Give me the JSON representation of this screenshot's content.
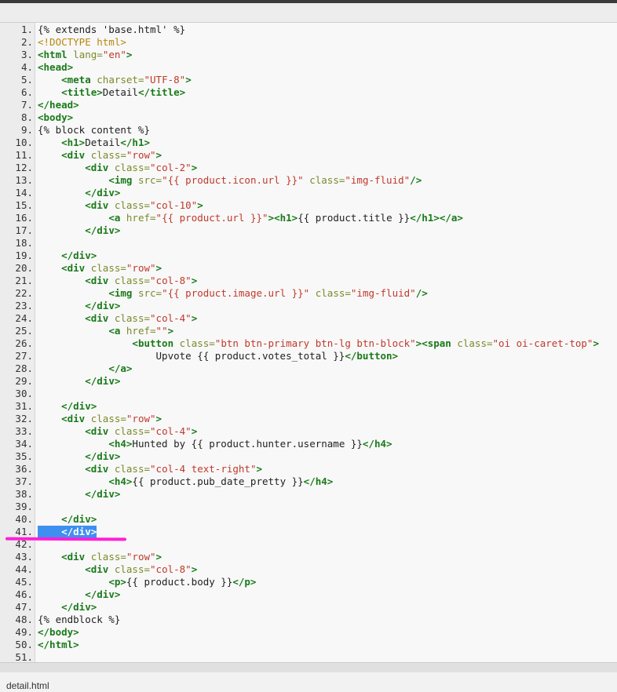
{
  "file": {
    "name": "detail.html"
  },
  "colors": {
    "tag": "#1a7a1a",
    "attr": "#7a8a2a",
    "string": "#c0392b",
    "selection": "#3d8ff0",
    "annotation": "#ff1fd8"
  },
  "selected_line": 41,
  "lines": [
    [
      [
        "tmpl",
        "{% extends 'base.html' %}"
      ]
    ],
    [
      [
        "doctype",
        "<!DOCTYPE html>"
      ]
    ],
    [
      [
        "tag",
        "<html"
      ],
      [
        "text",
        " "
      ],
      [
        "attr",
        "lang="
      ],
      [
        "str",
        "\"en\""
      ],
      [
        "tag",
        ">"
      ]
    ],
    [
      [
        "tag",
        "<head>"
      ]
    ],
    [
      [
        "text",
        "    "
      ],
      [
        "tag",
        "<meta"
      ],
      [
        "text",
        " "
      ],
      [
        "attr",
        "charset="
      ],
      [
        "str",
        "\"UTF-8\""
      ],
      [
        "tag",
        ">"
      ]
    ],
    [
      [
        "text",
        "    "
      ],
      [
        "tag",
        "<title>"
      ],
      [
        "text",
        "Detail"
      ],
      [
        "tag",
        "</title>"
      ]
    ],
    [
      [
        "tag",
        "</head>"
      ]
    ],
    [
      [
        "tag",
        "<body>"
      ]
    ],
    [
      [
        "tmpl",
        "{% block content %}"
      ]
    ],
    [
      [
        "text",
        "    "
      ],
      [
        "tag",
        "<h1>"
      ],
      [
        "text",
        "Detail"
      ],
      [
        "tag",
        "</h1>"
      ]
    ],
    [
      [
        "text",
        "    "
      ],
      [
        "tag",
        "<div"
      ],
      [
        "text",
        " "
      ],
      [
        "attr",
        "class="
      ],
      [
        "str",
        "\"row\""
      ],
      [
        "tag",
        ">"
      ]
    ],
    [
      [
        "text",
        "        "
      ],
      [
        "tag",
        "<div"
      ],
      [
        "text",
        " "
      ],
      [
        "attr",
        "class="
      ],
      [
        "str",
        "\"col-2\""
      ],
      [
        "tag",
        ">"
      ]
    ],
    [
      [
        "text",
        "            "
      ],
      [
        "tag",
        "<img"
      ],
      [
        "text",
        " "
      ],
      [
        "attr",
        "src="
      ],
      [
        "str",
        "\"{{ product.icon.url }}\""
      ],
      [
        "text",
        " "
      ],
      [
        "attr",
        "class="
      ],
      [
        "str",
        "\"img-fluid\""
      ],
      [
        "tag",
        "/>"
      ]
    ],
    [
      [
        "text",
        "        "
      ],
      [
        "tag",
        "</div>"
      ]
    ],
    [
      [
        "text",
        "        "
      ],
      [
        "tag",
        "<div"
      ],
      [
        "text",
        " "
      ],
      [
        "attr",
        "class="
      ],
      [
        "str",
        "\"col-10\""
      ],
      [
        "tag",
        ">"
      ]
    ],
    [
      [
        "text",
        "            "
      ],
      [
        "tag",
        "<a"
      ],
      [
        "text",
        " "
      ],
      [
        "attr",
        "href="
      ],
      [
        "str",
        "\"{{ product.url }}\""
      ],
      [
        "tag",
        "><h1>"
      ],
      [
        "text",
        "{{ product.title }}"
      ],
      [
        "tag",
        "</h1></a>"
      ]
    ],
    [
      [
        "text",
        "        "
      ],
      [
        "tag",
        "</div>"
      ]
    ],
    [],
    [
      [
        "text",
        "    "
      ],
      [
        "tag",
        "</div>"
      ]
    ],
    [
      [
        "text",
        "    "
      ],
      [
        "tag",
        "<div"
      ],
      [
        "text",
        " "
      ],
      [
        "attr",
        "class="
      ],
      [
        "str",
        "\"row\""
      ],
      [
        "tag",
        ">"
      ]
    ],
    [
      [
        "text",
        "        "
      ],
      [
        "tag",
        "<div"
      ],
      [
        "text",
        " "
      ],
      [
        "attr",
        "class="
      ],
      [
        "str",
        "\"col-8\""
      ],
      [
        "tag",
        ">"
      ]
    ],
    [
      [
        "text",
        "            "
      ],
      [
        "tag",
        "<img"
      ],
      [
        "text",
        " "
      ],
      [
        "attr",
        "src="
      ],
      [
        "str",
        "\"{{ product.image.url }}\""
      ],
      [
        "text",
        " "
      ],
      [
        "attr",
        "class="
      ],
      [
        "str",
        "\"img-fluid\""
      ],
      [
        "tag",
        "/>"
      ]
    ],
    [
      [
        "text",
        "        "
      ],
      [
        "tag",
        "</div>"
      ]
    ],
    [
      [
        "text",
        "        "
      ],
      [
        "tag",
        "<div"
      ],
      [
        "text",
        " "
      ],
      [
        "attr",
        "class="
      ],
      [
        "str",
        "\"col-4\""
      ],
      [
        "tag",
        ">"
      ]
    ],
    [
      [
        "text",
        "            "
      ],
      [
        "tag",
        "<a"
      ],
      [
        "text",
        " "
      ],
      [
        "attr",
        "href="
      ],
      [
        "str",
        "\"\""
      ],
      [
        "tag",
        ">"
      ]
    ],
    [
      [
        "text",
        "                "
      ],
      [
        "tag",
        "<button"
      ],
      [
        "text",
        " "
      ],
      [
        "attr",
        "class="
      ],
      [
        "str",
        "\"btn btn-primary btn-lg btn-block\""
      ],
      [
        "tag",
        "><span"
      ],
      [
        "text",
        " "
      ],
      [
        "attr",
        "class="
      ],
      [
        "str",
        "\"oi oi-caret-top\""
      ],
      [
        "tag",
        ">"
      ]
    ],
    [
      [
        "text",
        "                    Upvote {{ product.votes_total }}"
      ],
      [
        "tag",
        "</button>"
      ]
    ],
    [
      [
        "text",
        "            "
      ],
      [
        "tag",
        "</a>"
      ]
    ],
    [
      [
        "text",
        "        "
      ],
      [
        "tag",
        "</div>"
      ]
    ],
    [],
    [
      [
        "text",
        "    "
      ],
      [
        "tag",
        "</div>"
      ]
    ],
    [
      [
        "text",
        "    "
      ],
      [
        "tag",
        "<div"
      ],
      [
        "text",
        " "
      ],
      [
        "attr",
        "class="
      ],
      [
        "str",
        "\"row\""
      ],
      [
        "tag",
        ">"
      ]
    ],
    [
      [
        "text",
        "        "
      ],
      [
        "tag",
        "<div"
      ],
      [
        "text",
        " "
      ],
      [
        "attr",
        "class="
      ],
      [
        "str",
        "\"col-4\""
      ],
      [
        "tag",
        ">"
      ]
    ],
    [
      [
        "text",
        "            "
      ],
      [
        "tag",
        "<h4>"
      ],
      [
        "text",
        "Hunted by {{ product.hunter.username }}"
      ],
      [
        "tag",
        "</h4>"
      ]
    ],
    [
      [
        "text",
        "        "
      ],
      [
        "tag",
        "</div>"
      ]
    ],
    [
      [
        "text",
        "        "
      ],
      [
        "tag",
        "<div"
      ],
      [
        "text",
        " "
      ],
      [
        "attr",
        "class="
      ],
      [
        "str",
        "\"col-4 text-right\""
      ],
      [
        "tag",
        ">"
      ]
    ],
    [
      [
        "text",
        "            "
      ],
      [
        "tag",
        "<h4>"
      ],
      [
        "text",
        "{{ product.pub_date_pretty }}"
      ],
      [
        "tag",
        "</h4>"
      ]
    ],
    [
      [
        "text",
        "        "
      ],
      [
        "tag",
        "</div>"
      ]
    ],
    [],
    [
      [
        "text",
        "    "
      ],
      [
        "tag",
        "</div>"
      ]
    ],
    [
      [
        "text",
        "    "
      ],
      [
        "tag",
        "</div>"
      ]
    ],
    [],
    [
      [
        "text",
        "    "
      ],
      [
        "tag",
        "<div"
      ],
      [
        "text",
        " "
      ],
      [
        "attr",
        "class="
      ],
      [
        "str",
        "\"row\""
      ],
      [
        "tag",
        ">"
      ]
    ],
    [
      [
        "text",
        "        "
      ],
      [
        "tag",
        "<div"
      ],
      [
        "text",
        " "
      ],
      [
        "attr",
        "class="
      ],
      [
        "str",
        "\"col-8\""
      ],
      [
        "tag",
        ">"
      ]
    ],
    [
      [
        "text",
        "            "
      ],
      [
        "tag",
        "<p>"
      ],
      [
        "text",
        "{{ product.body }}"
      ],
      [
        "tag",
        "</p>"
      ]
    ],
    [
      [
        "text",
        "        "
      ],
      [
        "tag",
        "</div>"
      ]
    ],
    [
      [
        "text",
        "    "
      ],
      [
        "tag",
        "</div>"
      ]
    ],
    [
      [
        "tmpl",
        "{% endblock %}"
      ]
    ],
    [
      [
        "tag",
        "</body>"
      ]
    ],
    [
      [
        "tag",
        "</html>"
      ]
    ],
    []
  ]
}
